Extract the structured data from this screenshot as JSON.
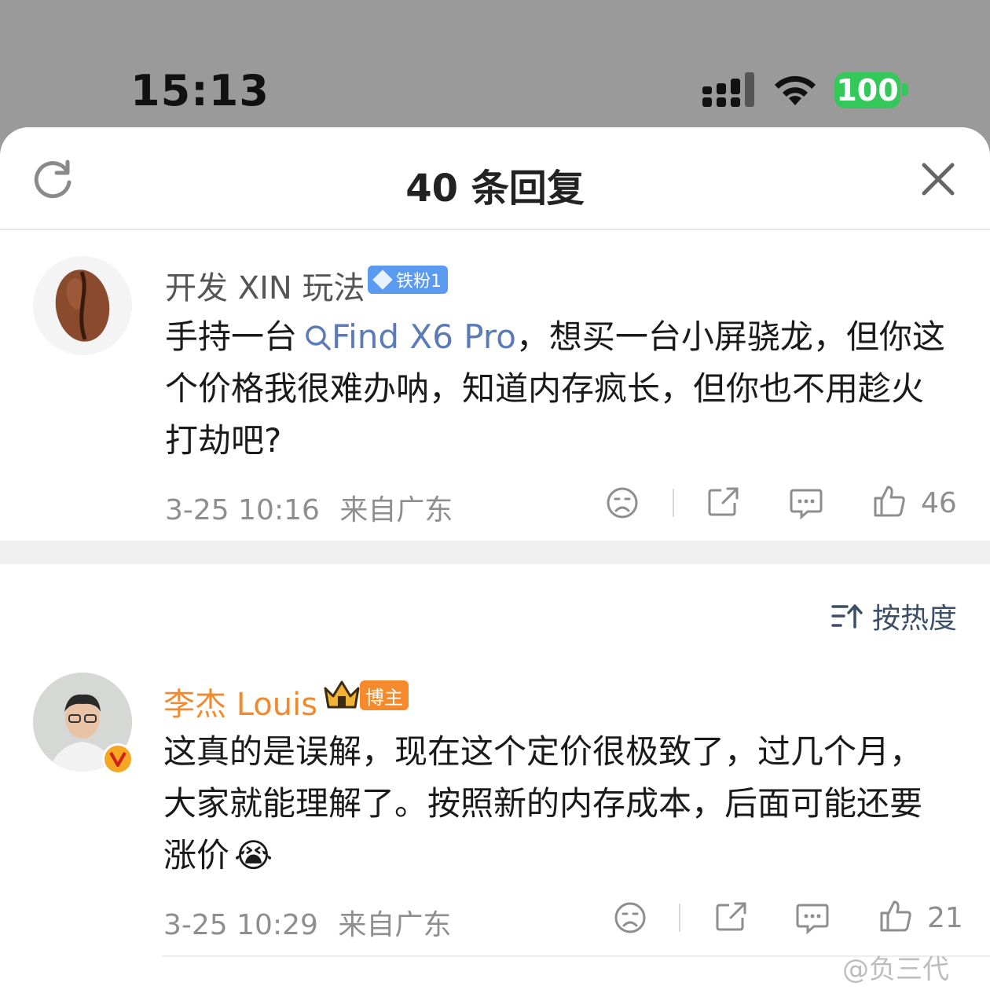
{
  "status_bar": {
    "time": "15:13",
    "battery": "100",
    "colors": {
      "battery": "#34c759"
    }
  },
  "sheet": {
    "title": "40 条回复",
    "refresh_icon": "refresh-icon",
    "close_icon": "close-icon"
  },
  "main_comment": {
    "username": "开发 XIN 玩法",
    "badge": "铁粉1",
    "text_before": "手持一台",
    "link_text": "Find X6 Pro",
    "text_after": "，想买一台小屏骁龙，但你这个价格我很难办呐，知道内存疯长，但你也不用趁火打劫吧?",
    "timestamp": "3-25 10:16",
    "location": "来自广东",
    "likes": "46"
  },
  "sort": {
    "label": "按热度"
  },
  "reply": {
    "username": "李杰 Louis",
    "badge": "博主",
    "text": "这真的是误解，现在这个定价很极致了，过几个月，大家就能理解了。按照新的内存成本，后面可能还要涨价",
    "emoji": "😭",
    "timestamp": "3-25 10:29",
    "location": "来自广东",
    "likes": "21"
  },
  "watermark": "@负三代",
  "colors": {
    "link": "#5b7ab8",
    "reply_name": "#f08a2d",
    "main_name": "#555555"
  }
}
